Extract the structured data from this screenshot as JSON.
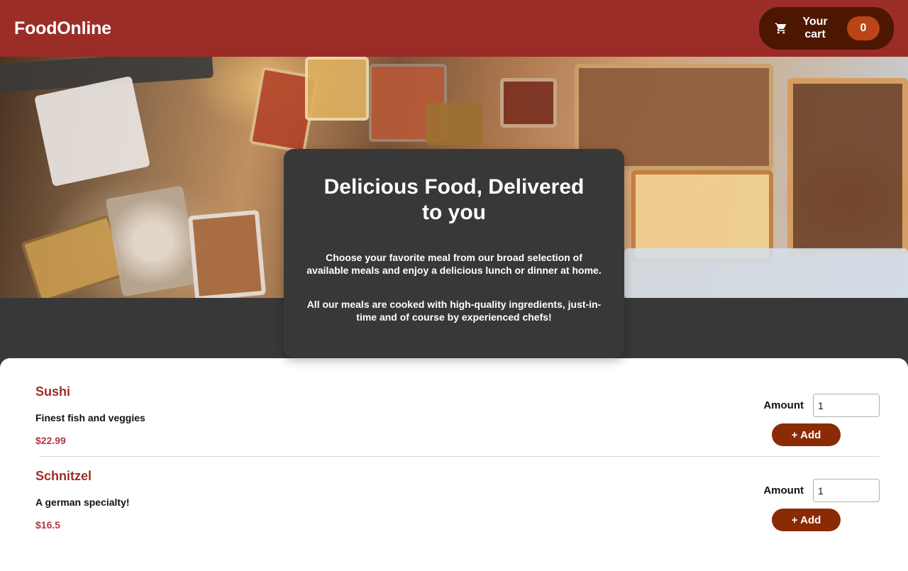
{
  "header": {
    "brand": "FoodOnline",
    "cart_label": "Your cart",
    "cart_count": "0"
  },
  "summary": {
    "title": "Delicious Food, Delivered to you",
    "paragraph1": "Choose your favorite meal from our broad selection of available meals and enjoy a delicious lunch or dinner at home.",
    "paragraph2": "All our meals are cooked with high-quality ingredients, just-in-time and of course by experienced chefs!"
  },
  "meals": [
    {
      "name": "Sushi",
      "description": "Finest fish and veggies",
      "price": "$22.99",
      "amount_label": "Amount",
      "amount_value": "1",
      "add_label": "+ Add"
    },
    {
      "name": "Schnitzel",
      "description": "A german specialty!",
      "price": "$16.5",
      "amount_label": "Amount",
      "amount_value": "1",
      "add_label": "+ Add"
    }
  ],
  "icons": {
    "cart": "shopping-cart-icon"
  },
  "colors": {
    "header": "#9c2e28",
    "cart_button": "#4d1601",
    "badge": "#b94517",
    "add_button": "#8a2b06",
    "meal_name": "#9c2e28",
    "price": "#b13a4e"
  }
}
